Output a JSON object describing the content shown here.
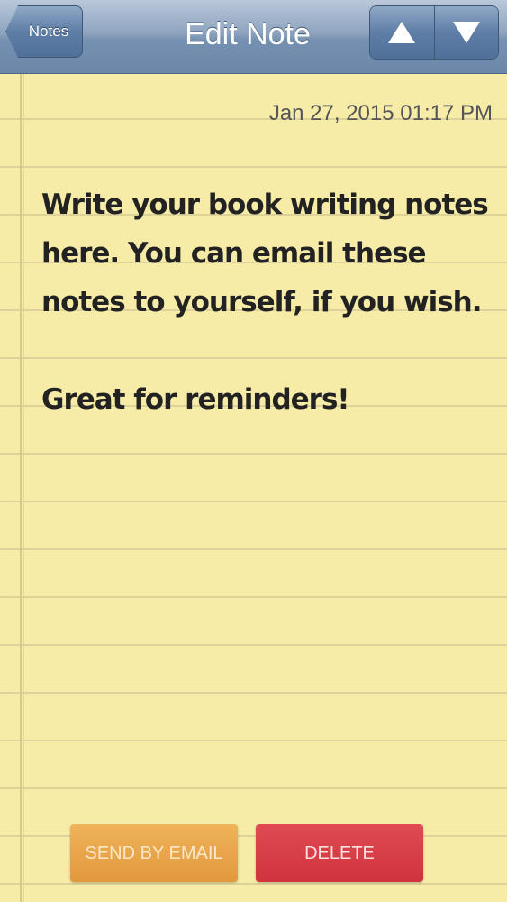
{
  "navbar": {
    "back_label": "Notes",
    "title": "Edit Note",
    "prev_icon": "up-triangle-icon",
    "next_icon": "down-triangle-icon"
  },
  "note": {
    "timestamp": "Jan 27, 2015 01:17 PM",
    "body": "Write your book writing notes here. You can email these notes to yourself, if you wish.\n\nGreat for reminders!"
  },
  "actions": {
    "email_label": "SEND BY EMAIL",
    "delete_label": "DELETE"
  },
  "colors": {
    "paper": "#f6eca8",
    "navbar": "#7590b1",
    "email_button": "#e2983c",
    "delete_button": "#cf343d"
  }
}
